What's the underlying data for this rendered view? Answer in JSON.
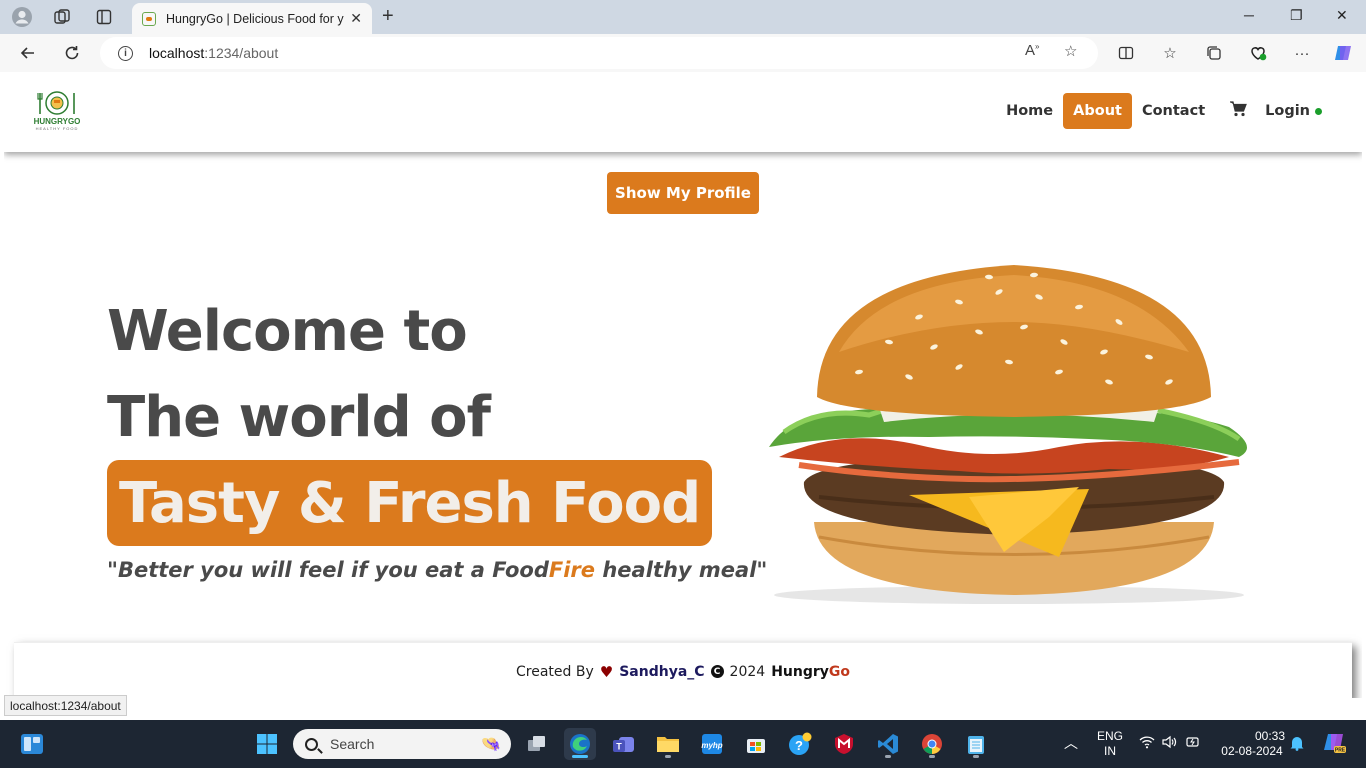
{
  "browser": {
    "tab_title": "HungryGo | Delicious Food for yo",
    "url_host": "localhost",
    "url_path": ":1234/about",
    "status_url": "localhost:1234/about"
  },
  "header": {
    "logo_text": "HUNGRYGO",
    "logo_sub": "HEALTHY FOOD",
    "nav": {
      "home": "Home",
      "about": "About",
      "contact": "Contact",
      "login": "Login"
    }
  },
  "main": {
    "profile_button": "Show My Profile",
    "hero_line1": "Welcome to",
    "hero_line2": "The world of",
    "hero_highlight": "Tasty & Fresh Food",
    "tagline_part1": "\"Better you will feel if you eat a Food",
    "tagline_accent": "Fire",
    "tagline_part2": " healthy meal\""
  },
  "footer": {
    "created_by": "Created By",
    "author": "Sandhya_C",
    "year": "2024",
    "brand_main": "Hungry",
    "brand_accent": "Go"
  },
  "taskbar": {
    "search_placeholder": "Search",
    "lang_line1": "ENG",
    "lang_line2": "IN",
    "time": "00:33",
    "date": "02-08-2024"
  },
  "colors": {
    "accent": "#db7a1d",
    "taskbar": "#1d2633"
  }
}
